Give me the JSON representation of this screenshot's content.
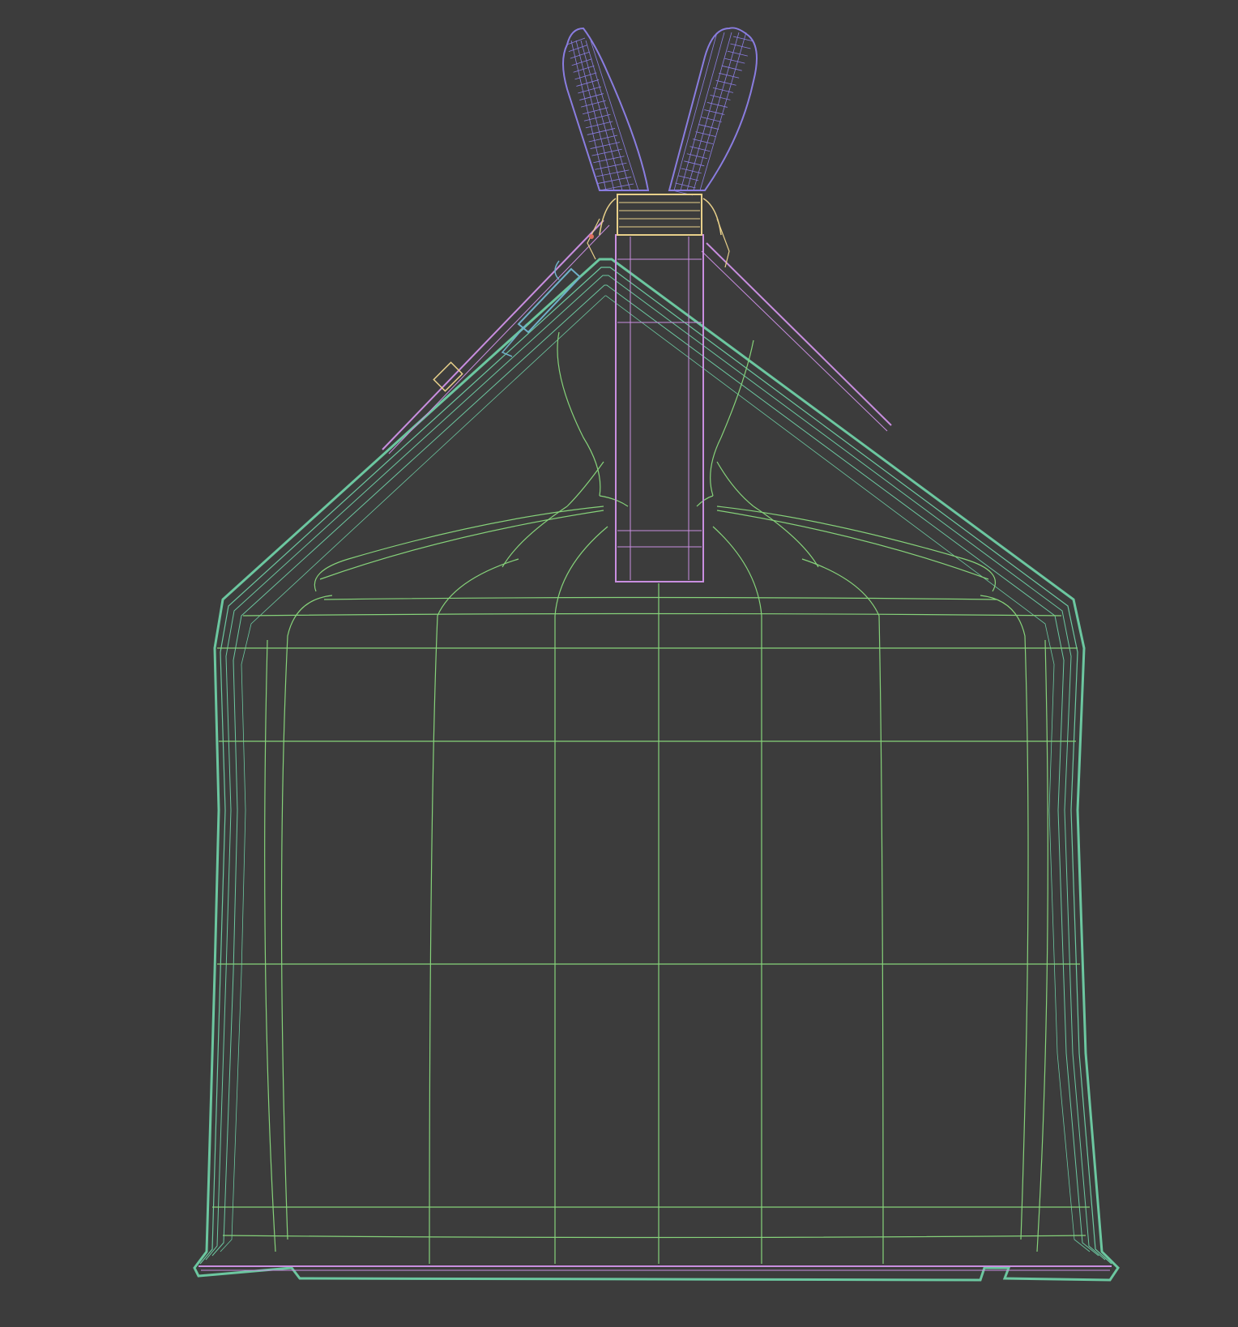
{
  "viewport": {
    "background_color": "#3c3c3c",
    "view_mode": "wireframe",
    "subject": "bag"
  },
  "wire_colors": {
    "body_outer": "#6cc7a0",
    "body_inner_grid": "#86d27a",
    "top_panel_trim": "#c98ee0",
    "handles": "#8a7de0",
    "hardware": "#e8d08a",
    "zipper_puller": "#6fb0c8",
    "accent": "#e07060"
  },
  "parts": [
    {
      "name": "bag-body",
      "color_key": "body_outer"
    },
    {
      "name": "body-grid",
      "color_key": "body_inner_grid"
    },
    {
      "name": "front-strap",
      "color_key": "top_panel_trim"
    },
    {
      "name": "handle-left",
      "color_key": "handles"
    },
    {
      "name": "handle-right",
      "color_key": "handles"
    },
    {
      "name": "top-clasp",
      "color_key": "hardware"
    },
    {
      "name": "zipper-pull",
      "color_key": "zipper_puller"
    },
    {
      "name": "base-strip",
      "color_key": "top_panel_trim"
    }
  ]
}
